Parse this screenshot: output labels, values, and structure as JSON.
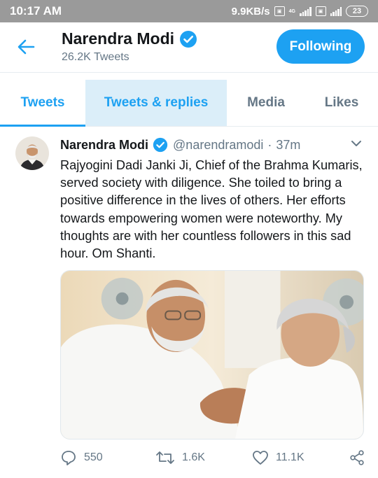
{
  "status_bar": {
    "time": "10:17 AM",
    "speed": "9.9KB/s",
    "net_icon": "vo-lte-icon",
    "network": "4G",
    "battery": "23"
  },
  "header": {
    "back_icon": "arrow-left-icon",
    "name": "Narendra Modi",
    "verified_icon": "verified-badge-icon",
    "tweet_count": "26.2K Tweets",
    "follow_button": "Following"
  },
  "tabs": [
    {
      "label": "Tweets",
      "selected": true
    },
    {
      "label": "Tweets & replies",
      "selected": false
    },
    {
      "label": "Media",
      "selected": false
    },
    {
      "label": "Likes",
      "selected": false
    }
  ],
  "tweet": {
    "author": "Narendra Modi",
    "handle": "@narendramodi",
    "separator": "·",
    "time": "37m",
    "text": "Rajyogini Dadi Janki Ji, Chief of the Brahma Kumaris, served society with diligence. She toiled to bring a positive difference in the lives of others. Her efforts towards empowering women were noteworthy. My thoughts are with her countless followers in this sad hour. Om Shanti.",
    "replies": "550",
    "retweets": "1.6K",
    "likes": "11.1K"
  },
  "colors": {
    "accent": "#1da1f2",
    "tab_highlight": "#dbeef9",
    "secondary_text": "#657786",
    "status_bar": "#9a9a9a"
  }
}
